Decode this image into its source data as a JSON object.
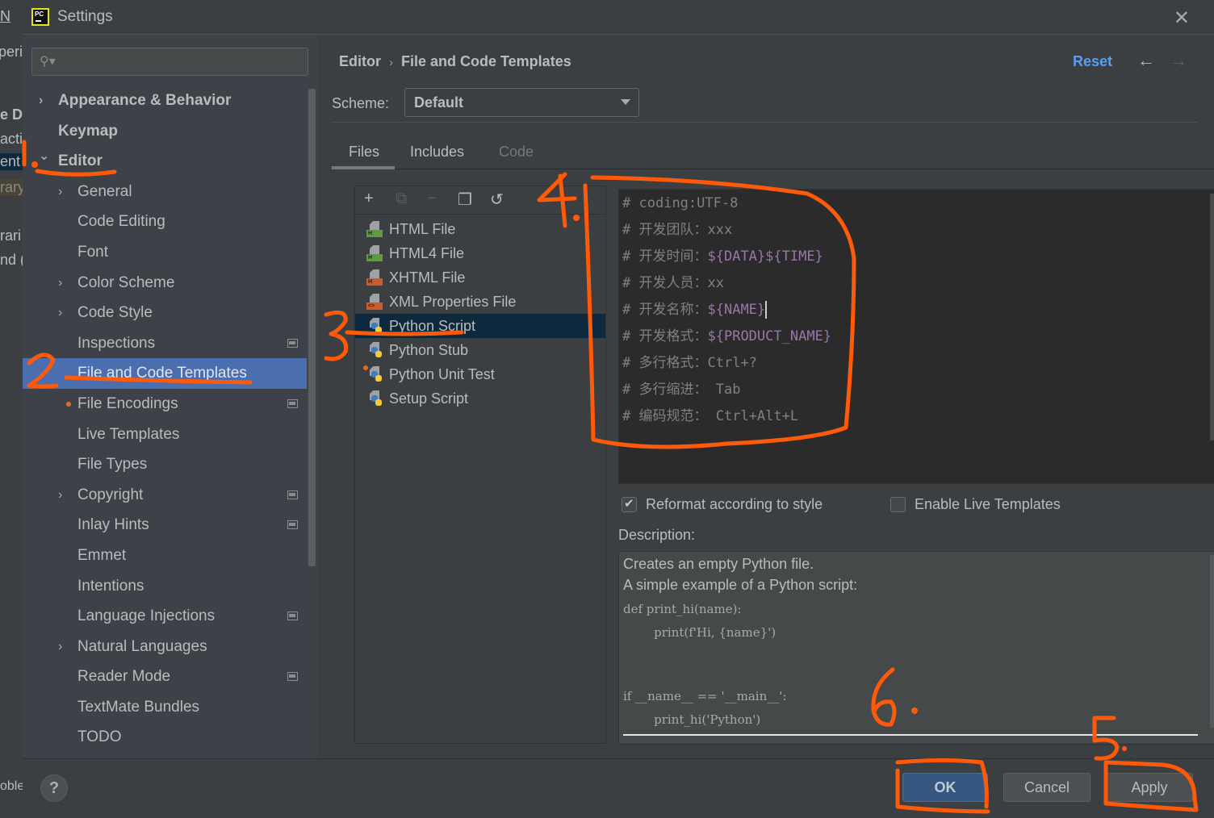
{
  "background_app": {
    "fragments": [
      "N",
      "peri",
      "e D",
      "acti",
      "ent",
      "rary",
      "rari",
      "nd (",
      "oble"
    ]
  },
  "window": {
    "title": "Settings",
    "logo_text": "PC"
  },
  "search": {
    "placeholder": "",
    "value": ""
  },
  "sidebar": {
    "items": [
      {
        "label": "Appearance & Behavior",
        "level": 0,
        "expandable": true,
        "expanded": false,
        "bold": true
      },
      {
        "label": "Keymap",
        "level": 0,
        "expandable": false,
        "bold": true
      },
      {
        "label": "Editor",
        "level": 0,
        "expandable": true,
        "expanded": true,
        "bold": true
      },
      {
        "label": "General",
        "level": 1,
        "expandable": true
      },
      {
        "label": "Code Editing",
        "level": 1
      },
      {
        "label": "Font",
        "level": 1
      },
      {
        "label": "Color Scheme",
        "level": 1,
        "expandable": true
      },
      {
        "label": "Code Style",
        "level": 1,
        "expandable": true
      },
      {
        "label": "Inspections",
        "level": 1,
        "project_badge": true
      },
      {
        "label": "File and Code Templates",
        "level": 1,
        "selected": true
      },
      {
        "label": "File Encodings",
        "level": 1,
        "project_badge": true,
        "modified_dot": true
      },
      {
        "label": "Live Templates",
        "level": 1
      },
      {
        "label": "File Types",
        "level": 1
      },
      {
        "label": "Copyright",
        "level": 1,
        "expandable": true,
        "project_badge": true
      },
      {
        "label": "Inlay Hints",
        "level": 1,
        "project_badge": true
      },
      {
        "label": "Emmet",
        "level": 1
      },
      {
        "label": "Intentions",
        "level": 1
      },
      {
        "label": "Language Injections",
        "level": 1,
        "project_badge": true
      },
      {
        "label": "Natural Languages",
        "level": 1,
        "expandable": true
      },
      {
        "label": "Reader Mode",
        "level": 1,
        "project_badge": true
      },
      {
        "label": "TextMate Bundles",
        "level": 1
      },
      {
        "label": "TODO",
        "level": 1
      }
    ]
  },
  "header": {
    "breadcrumb": [
      "Editor",
      "File and Code Templates"
    ],
    "breadcrumb_separator": "›",
    "reset_label": "Reset",
    "back_icon": "←",
    "forward_icon": "→"
  },
  "scheme": {
    "label": "Scheme:",
    "selected": "Default"
  },
  "tabs": [
    {
      "label": "Files",
      "active": true
    },
    {
      "label": "Includes",
      "active": false
    },
    {
      "label": "Code",
      "active": false,
      "disabled": true
    }
  ],
  "toolbar": {
    "add_icon": "+",
    "copy_add_icon": "⧉",
    "remove_icon": "−",
    "duplicate_icon": "❐",
    "reset_icon": "↺"
  },
  "templates": [
    {
      "name": "HTML File",
      "icon": "html-file-icon",
      "tag": "H",
      "tag_color": "#5e9c3c"
    },
    {
      "name": "HTML4 File",
      "icon": "html-file-icon",
      "tag": "H",
      "tag_color": "#5e9c3c"
    },
    {
      "name": "XHTML File",
      "icon": "xhtml-file-icon",
      "tag": "H",
      "tag_color": "#cc5b2b"
    },
    {
      "name": "XML Properties File",
      "icon": "xml-file-icon",
      "tag": "<>",
      "tag_color": "#cc5b2b"
    },
    {
      "name": "Python Script",
      "icon": "python-file-icon",
      "selected": true
    },
    {
      "name": "Python Stub",
      "icon": "python-file-icon"
    },
    {
      "name": "Python Unit Test",
      "icon": "python-file-icon",
      "modified_dot": true
    },
    {
      "name": "Setup Script",
      "icon": "python-file-icon"
    }
  ],
  "editor": {
    "lines": [
      {
        "hash": "#",
        "label": "",
        "plain": "coding:UTF-8",
        "var": ""
      },
      {
        "hash": "#",
        "label": "开发团队：",
        "plain": "xxx",
        "var": ""
      },
      {
        "hash": "#",
        "label": "开发时间：",
        "plain": "",
        "var": "${DATA}${TIME}"
      },
      {
        "hash": "#",
        "label": "开发人员：",
        "plain": "xx",
        "var": ""
      },
      {
        "hash": "#",
        "label": "开发名称：",
        "plain": "",
        "var": "${NAME}",
        "caret": true
      },
      {
        "hash": "#",
        "label": "开发格式：",
        "plain": "",
        "var": "${PRODUCT_NAME}"
      },
      {
        "hash": "#",
        "label": "多行格式：",
        "plain": "Ctrl+?",
        "var": ""
      },
      {
        "hash": "#",
        "label": "多行缩进：",
        "plain": " Tab",
        "var": ""
      },
      {
        "hash": "#",
        "label": "编码规范：",
        "plain": " Ctrl+Alt+L",
        "var": ""
      }
    ]
  },
  "options": {
    "reformat": {
      "label": "Reformat according to style",
      "checked": true
    },
    "live_templates": {
      "label": "Enable Live Templates",
      "checked": false
    }
  },
  "description": {
    "label": "Description:",
    "text_lines": [
      "Creates an empty Python file.",
      "A simple example of a Python script:"
    ],
    "code_lines": [
      "def print_hi(name):",
      "        print(f'Hi, {name}')",
      "",
      "",
      "if __name__ == '__main__':",
      "        print_hi('Python')"
    ]
  },
  "footer": {
    "help_label": "?",
    "ok_label": "OK",
    "cancel_label": "Cancel",
    "apply_label": "Apply"
  },
  "annotations": {
    "color": "#ff5a0a",
    "marks": [
      "1.",
      "2",
      "3",
      "4.",
      "5.",
      "6."
    ]
  }
}
